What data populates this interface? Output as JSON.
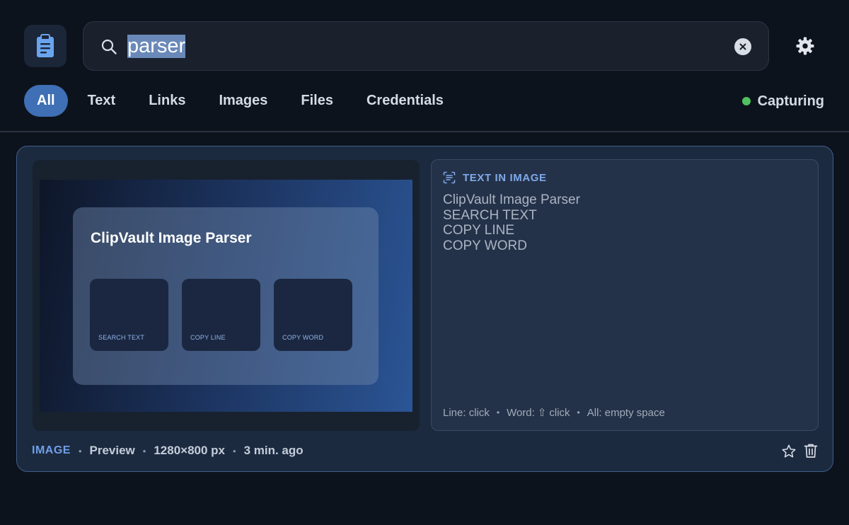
{
  "search": {
    "value": "parser",
    "placeholder": ""
  },
  "icons": {
    "app": "clipboard-icon",
    "search": "search-icon",
    "clear": "clear-icon",
    "settings": "gear-icon",
    "ocr": "text-scan-icon",
    "favorite": "star-icon",
    "delete": "trash-icon"
  },
  "tabs": [
    {
      "label": "All",
      "active": true
    },
    {
      "label": "Text"
    },
    {
      "label": "Links"
    },
    {
      "label": "Images"
    },
    {
      "label": "Files"
    },
    {
      "label": "Credentials"
    }
  ],
  "status": {
    "label": "Capturing",
    "color": "#4fc15f"
  },
  "card": {
    "preview": {
      "title": "ClipVault Image Parser",
      "buttons": [
        "SEARCH TEXT",
        "COPY LINE",
        "COPY WORD"
      ]
    },
    "ocr": {
      "header": "TEXT IN IMAGE",
      "lines": [
        "ClipVault Image Parser",
        "SEARCH TEXT",
        "COPY LINE",
        "COPY WORD"
      ],
      "hint": {
        "line": "Line: click",
        "word_prefix": "Word:",
        "word_key": "⇧",
        "word_suffix": "click",
        "all": "All: empty space",
        "separator": "•"
      }
    },
    "footer": {
      "type": "IMAGE",
      "source": "Preview",
      "dimensions": "1280×800 px",
      "time": "3 min. ago",
      "separator": "•"
    }
  },
  "colors": {
    "accent": "#3f6fb4",
    "background": "#0d131c",
    "card": "#1c2a40",
    "label": "#6f9fe6"
  }
}
